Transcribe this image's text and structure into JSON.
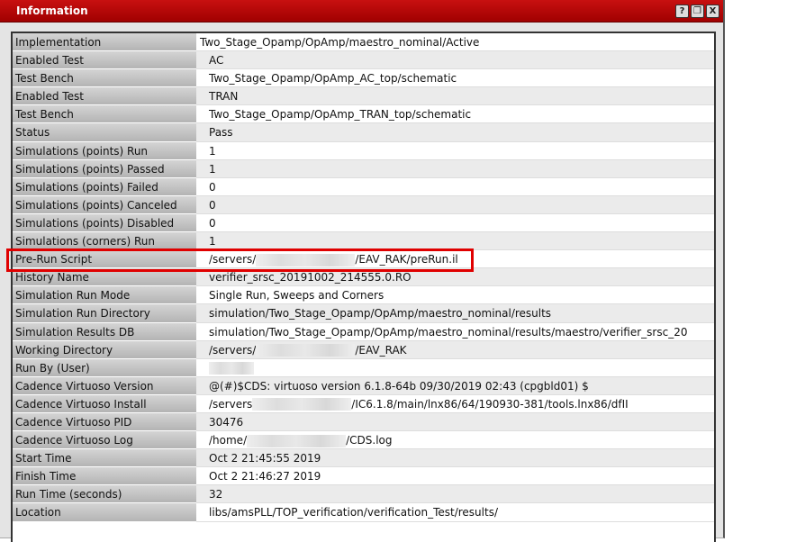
{
  "window": {
    "title": "Information",
    "buttons": [
      "?",
      "❐",
      "X"
    ]
  },
  "rows": [
    {
      "label": "Implementation",
      "value": [
        "Two_Stage_Opamp/OpAmp/maestro_nominal/Active"
      ]
    },
    {
      "label": "Enabled Test",
      "value": [
        "AC"
      ]
    },
    {
      "label": "Test Bench",
      "value": [
        "Two_Stage_Opamp/OpAmp_AC_top/schematic"
      ]
    },
    {
      "label": "Enabled Test",
      "value": [
        "TRAN"
      ]
    },
    {
      "label": "Test Bench",
      "value": [
        "Two_Stage_Opamp/OpAmp_TRAN_top/schematic"
      ]
    },
    {
      "label": "Status",
      "value": [
        "Pass"
      ]
    },
    {
      "label": "Simulations (points) Run",
      "value": [
        "1"
      ]
    },
    {
      "label": "Simulations (points) Passed",
      "value": [
        "1"
      ]
    },
    {
      "label": "Simulations (points) Failed",
      "value": [
        "0"
      ]
    },
    {
      "label": "Simulations (points) Canceled",
      "value": [
        "0"
      ]
    },
    {
      "label": "Simulations (points) Disabled",
      "value": [
        "0"
      ]
    },
    {
      "label": "Simulations (corners) Run",
      "value": [
        "1"
      ]
    },
    {
      "label": "Pre-Run Script",
      "value": [
        "/servers/",
        "/EAV_RAK/preRun.il"
      ]
    },
    {
      "label": "History Name",
      "value": [
        "verifier_srsc_20191002_214555.0.RO"
      ]
    },
    {
      "label": "Simulation Run Mode",
      "value": [
        "Single Run, Sweeps and Corners"
      ]
    },
    {
      "label": "Simulation Run Directory",
      "value": [
        "simulation/Two_Stage_Opamp/OpAmp/maestro_nominal/results"
      ]
    },
    {
      "label": "Simulation Results DB",
      "value": [
        "simulation/Two_Stage_Opamp/OpAmp/maestro_nominal/results/maestro/verifier_srsc_20"
      ]
    },
    {
      "label": "Working Directory",
      "value": [
        "/servers/",
        "/EAV_RAK"
      ]
    },
    {
      "label": "Run By (User)",
      "value": [
        "",
        ""
      ]
    },
    {
      "label": "Cadence Virtuoso Version",
      "value": [
        "@(#)$CDS: virtuoso version 6.1.8-64b 09/30/2019 02:43 (cpgbld01) $"
      ]
    },
    {
      "label": "Cadence Virtuoso Install",
      "value": [
        "/servers",
        "/IC6.1.8/main/lnx86/64/190930-381/tools.lnx86/dfII"
      ]
    },
    {
      "label": "Cadence Virtuoso PID",
      "value": [
        "30476"
      ]
    },
    {
      "label": "Cadence Virtuoso Log",
      "value": [
        "/home/",
        "/CDS.log"
      ]
    },
    {
      "label": "Start Time",
      "value": [
        "Oct  2 21:45:55 2019"
      ]
    },
    {
      "label": "Finish Time",
      "value": [
        "Oct  2 21:46:27 2019"
      ]
    },
    {
      "label": "Run Time (seconds)",
      "value": [
        "32"
      ]
    },
    {
      "label": "Location",
      "value": [
        "libs/amsPLL/TOP_verification/verification_Test/results/"
      ]
    }
  ],
  "highlight_color": "#e00000"
}
